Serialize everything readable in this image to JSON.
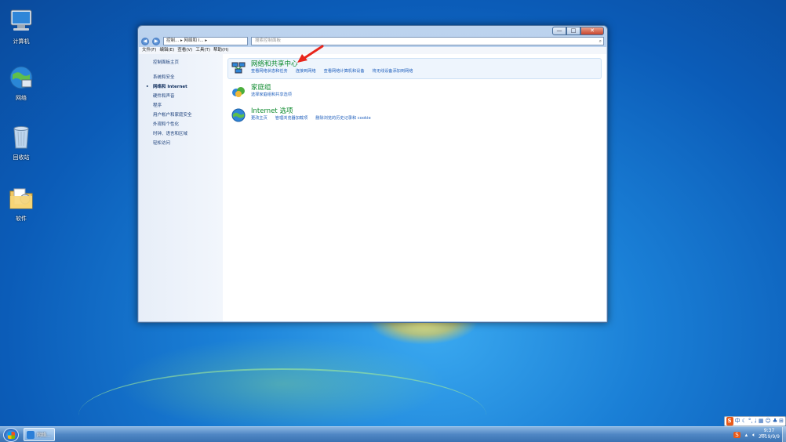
{
  "desktop": {
    "icons": [
      {
        "label": "计算机",
        "icon": "computer-icon"
      },
      {
        "label": "网络",
        "icon": "network-globe-icon"
      },
      {
        "label": "回收站",
        "icon": "recycle-bin-icon"
      },
      {
        "label": "软件",
        "icon": "folder-icon"
      }
    ]
  },
  "window": {
    "caption_buttons": {
      "minimize": "—",
      "maximize": "□",
      "close": "✕"
    },
    "address": "控制... ▸ 网络和 I... ▸",
    "search_placeholder": "搜索控制面板",
    "menu": [
      "文件(F)",
      "编辑(E)",
      "查看(V)",
      "工具(T)",
      "帮助(H)"
    ],
    "sidebar": {
      "home": "控制面板主页",
      "items": [
        "系统和安全",
        "网络和 Internet",
        "硬件和声音",
        "程序",
        "用户帐户和家庭安全",
        "外观和个性化",
        "时钟、语言和区域",
        "轻松访问"
      ],
      "current_index": 1
    },
    "categories": [
      {
        "title": "网络和共享中心",
        "icon": "network-sharing-center-icon",
        "links": [
          "查看网络状态和任务",
          "连接到网络",
          "查看网络计算机和设备",
          "将无线设备添加到网络"
        ]
      },
      {
        "title": "家庭组",
        "icon": "homegroup-icon",
        "links": [
          "选择家庭组和共享选项"
        ]
      },
      {
        "title": "Internet 选项",
        "icon": "internet-options-globe-icon",
        "links": [
          "更改主页",
          "管理浏览器加载项",
          "删除浏览的历史记录和 cookie"
        ]
      }
    ]
  },
  "taskbar": {
    "task_label": "网络...",
    "ime": {
      "logo": "S",
      "mode": "中"
    },
    "clock": {
      "time": "9:37",
      "date": "2019/9/9"
    }
  },
  "colors": {
    "accent_arrow": "#e8261c",
    "category_title": "#0e8a2e",
    "link": "#1f5fbd"
  }
}
